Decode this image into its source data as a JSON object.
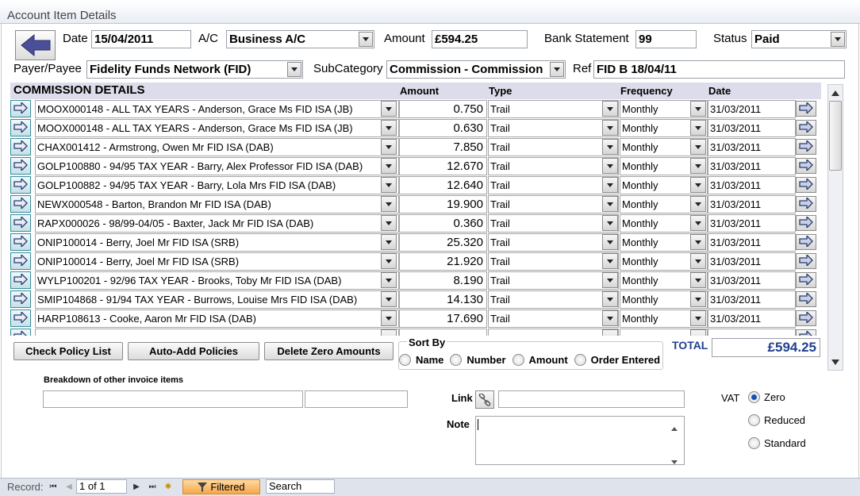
{
  "window": {
    "title": "Account Item Details"
  },
  "header": {
    "date_label": "Date",
    "date_value": "15/04/2011",
    "ac_label": "A/C",
    "ac_value": "Business A/C",
    "amount_label": "Amount",
    "amount_value": "£594.25",
    "bank_label": "Bank Statement",
    "bank_value": "99",
    "status_label": "Status",
    "status_value": "Paid",
    "payer_label": "Payer/Payee",
    "payer_value": "Fidelity Funds Network (FID)",
    "subcat_label": "SubCategory",
    "subcat_value": "Commission - Commission",
    "ref_label": "Ref",
    "ref_value": "FID B 18/04/11"
  },
  "details": {
    "title": "COMMISSION DETAILS",
    "columns": {
      "amount": "Amount",
      "type": "Type",
      "frequency": "Frequency",
      "date": "Date"
    },
    "rows": [
      {
        "policy": "MOOX000148 - ALL TAX YEARS - Anderson, Grace Ms FID ISA  (JB)",
        "amount": "0.750",
        "type": "Trail",
        "frequency": "Monthly",
        "date": "31/03/2011"
      },
      {
        "policy": "MOOX000148 - ALL TAX YEARS - Anderson, Grace Ms FID ISA  (JB)",
        "amount": "0.630",
        "type": "Trail",
        "frequency": "Monthly",
        "date": "31/03/2011"
      },
      {
        "policy": "CHAX001412 - Armstrong, Owen Mr FID ISA  (DAB)",
        "amount": "7.850",
        "type": "Trail",
        "frequency": "Monthly",
        "date": "31/03/2011"
      },
      {
        "policy": "GOLP100880 - 94/95 TAX YEAR - Barry, Alex Professor FID ISA  (DAB)",
        "amount": "12.670",
        "type": "Trail",
        "frequency": "Monthly",
        "date": "31/03/2011"
      },
      {
        "policy": "GOLP100882 - 94/95 TAX YEAR - Barry, Lola Mrs FID ISA  (DAB)",
        "amount": "12.640",
        "type": "Trail",
        "frequency": "Monthly",
        "date": "31/03/2011"
      },
      {
        "policy": "NEWX000548 - Barton, Brandon Mr FID ISA  (DAB)",
        "amount": "19.900",
        "type": "Trail",
        "frequency": "Monthly",
        "date": "31/03/2011"
      },
      {
        "policy": "RAPX000026 - 98/99-04/05 - Baxter, Jack Mr FID ISA  (DAB)",
        "amount": "0.360",
        "type": "Trail",
        "frequency": "Monthly",
        "date": "31/03/2011"
      },
      {
        "policy": "ONIP100014 - Berry, Joel Mr FID ISA  (SRB)",
        "amount": "25.320",
        "type": "Trail",
        "frequency": "Monthly",
        "date": "31/03/2011"
      },
      {
        "policy": "ONIP100014 - Berry, Joel Mr FID ISA  (SRB)",
        "amount": "21.920",
        "type": "Trail",
        "frequency": "Monthly",
        "date": "31/03/2011"
      },
      {
        "policy": "WYLP100201 - 92/96 TAX YEAR - Brooks, Toby Mr FID ISA  (DAB)",
        "amount": "8.190",
        "type": "Trail",
        "frequency": "Monthly",
        "date": "31/03/2011"
      },
      {
        "policy": "SMIP104868 - 91/94 TAX YEAR - Burrows, Louise Mrs FID ISA  (DAB)",
        "amount": "14.130",
        "type": "Trail",
        "frequency": "Monthly",
        "date": "31/03/2011"
      },
      {
        "policy": "HARP108613 - Cooke, Aaron Mr FID ISA  (DAB)",
        "amount": "17.690",
        "type": "Trail",
        "frequency": "Monthly",
        "date": "31/03/2011"
      },
      {
        "policy": "",
        "amount": "",
        "type": "",
        "frequency": "",
        "date": ""
      }
    ]
  },
  "buttons": {
    "check": "Check Policy List",
    "auto_add": "Auto-Add Policies",
    "delete_zero": "Delete Zero Amounts"
  },
  "sort": {
    "label": "Sort By",
    "options": [
      "Name",
      "Number",
      "Amount",
      "Order Entered"
    ],
    "selected": ""
  },
  "total": {
    "label": "TOTAL",
    "value": "£594.25"
  },
  "breakdown": {
    "label": "Breakdown of other invoice items"
  },
  "link": {
    "label": "Link"
  },
  "note": {
    "label": "Note"
  },
  "vat": {
    "label": "VAT",
    "options": [
      "Zero",
      "Reduced",
      "Standard"
    ],
    "selected": "Zero"
  },
  "status_bar": {
    "record_label": "Record:",
    "record_value": "1 of 1",
    "filter_label": "Filtered",
    "search_placeholder": "Search"
  },
  "colors": {
    "accent": "#1f3f8f",
    "header_band": "#dcdcea",
    "filter": "#f6a64a"
  }
}
